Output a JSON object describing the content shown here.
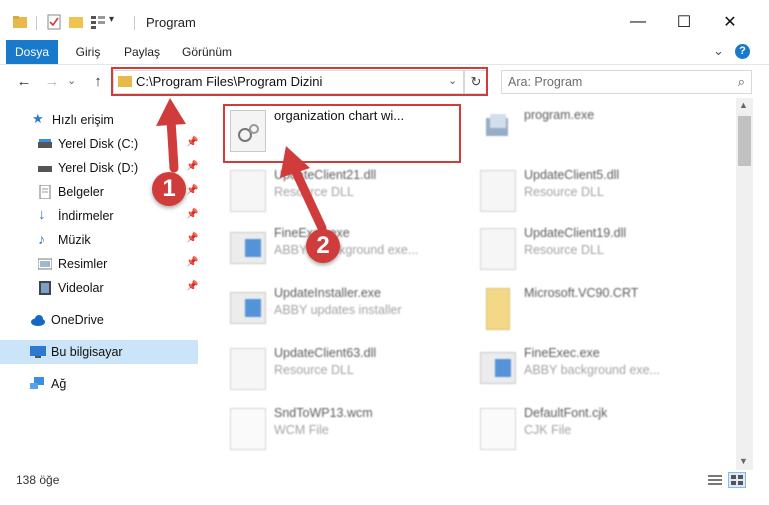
{
  "window": {
    "title": "Program",
    "minimize": "—",
    "maximize": "☐",
    "close": "✕"
  },
  "ribbon": {
    "tabs": [
      "Dosya",
      "Giriş",
      "Paylaş",
      "Görünüm"
    ],
    "collapse": "⌄",
    "help": "?"
  },
  "address": {
    "back": "←",
    "forward": "→",
    "recent": "⌄",
    "up": "↑",
    "path": "C:\\Program Files\\Program Dizini",
    "dropdown": "⌄",
    "refresh": "↻"
  },
  "search": {
    "placeholder": "Ara: Program",
    "icon": "⌕"
  },
  "sidebar": {
    "quick_access": "Hızlı erişim",
    "items": [
      {
        "label": "Yerel Disk (C:)",
        "icon": "drive-icon"
      },
      {
        "label": "Yerel Disk (D:)",
        "icon": "drive-icon"
      },
      {
        "label": "Belgeler",
        "icon": "documents-icon"
      },
      {
        "label": "İndirmeler",
        "icon": "download-icon"
      },
      {
        "label": "Müzik",
        "icon": "music-icon"
      },
      {
        "label": "Resimler",
        "icon": "pictures-icon"
      },
      {
        "label": "Videolar",
        "icon": "video-icon"
      }
    ],
    "pin": "📌",
    "onedrive": "OneDrive",
    "this_pc": "Bu bilgisayar",
    "network": "Ağ"
  },
  "files": {
    "highlighted": {
      "name": "organization chart wi..."
    },
    "items": [
      {
        "name": "program.exe",
        "type": ""
      },
      {
        "name": "UpdateClient21.dll",
        "type": "Resource DLL"
      },
      {
        "name": "UpdateClient5.dll",
        "type": "Resource DLL"
      },
      {
        "name": "FineExec.exe",
        "type": "ABBYY background exe..."
      },
      {
        "name": "UpdateClient19.dll",
        "type": "Resource DLL"
      },
      {
        "name": "UpdateInstaller.exe",
        "type": "ABBY updates installer"
      },
      {
        "name": "Microsoft.VC90.CRT",
        "type": ""
      },
      {
        "name": "UpdateClient63.dll",
        "type": "Resource DLL"
      },
      {
        "name": "FineExec.exe",
        "type": "ABBY background exe..."
      },
      {
        "name": "SndToWP13.wcm",
        "type": "WCM File"
      },
      {
        "name": "DefaultFont.cjk",
        "type": "CJK File"
      }
    ]
  },
  "status": {
    "count": "138 öğe"
  },
  "annotations": {
    "marker1": "1",
    "marker2": "2",
    "color": "#d03c3c"
  }
}
